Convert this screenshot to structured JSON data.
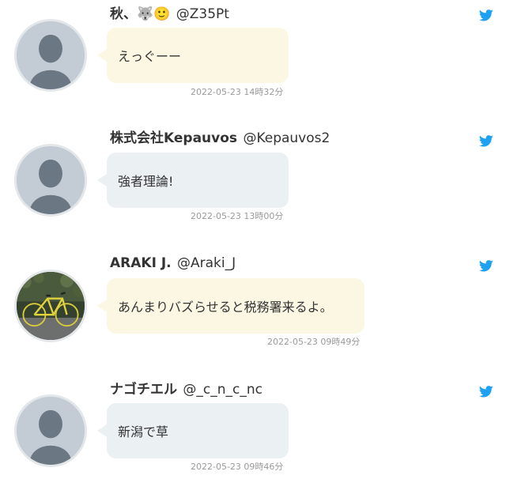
{
  "colors": {
    "bubble_yellow": "#fbf7e3",
    "bubble_gray": "#ebf0f2",
    "twitter_blue": "#1da1f2",
    "avatar_placeholder_bg": "#c3ccd4",
    "avatar_placeholder_figure": "#6b7782"
  },
  "tweets": [
    {
      "display_name": "秋、",
      "emojis": "🐺🙂",
      "handle": "@Z35Pt",
      "text": "えっぐーー",
      "timestamp": "2022-05-23 14時32分",
      "bubble_color": "yellow",
      "avatar": "default-avatar-icon",
      "service_icon": "twitter-bird-icon"
    },
    {
      "display_name": "株式会社Kepauvos",
      "handle": "@Kepauvos2",
      "text": "強者理論!",
      "timestamp": "2022-05-23 13時00分",
      "bubble_color": "gray",
      "avatar": "default-avatar-icon",
      "service_icon": "twitter-bird-icon"
    },
    {
      "display_name": "ARAKI J.",
      "handle": "@Araki_J",
      "text": "あんまりバズらせると税務署来るよ。",
      "timestamp": "2022-05-23 09時49分",
      "bubble_color": "yellow",
      "avatar": "bicycle-photo",
      "service_icon": "twitter-bird-icon"
    },
    {
      "display_name": "ナゴチエル",
      "handle": "@_c_n_c_nc",
      "text": "新潟で草",
      "timestamp": "2022-05-23 09時46分",
      "bubble_color": "gray",
      "avatar": "default-avatar-icon",
      "service_icon": "twitter-bird-icon"
    }
  ]
}
